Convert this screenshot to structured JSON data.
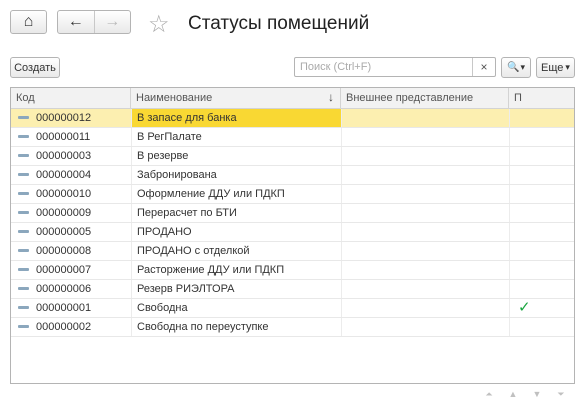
{
  "window": {
    "title": "Статусы помещений"
  },
  "toolbar": {
    "create_label": "Создать",
    "search_placeholder": "Поиск (Ctrl+F)",
    "clear_glyph": "×",
    "search_glyph": "🔍",
    "dropdown_glyph": "▾",
    "more_label": "Еще",
    "more_glyph": "▾"
  },
  "nav": {
    "home_glyph": "⌂",
    "back_glyph": "←",
    "forward_glyph": "→",
    "star_glyph": "☆"
  },
  "table": {
    "columns": [
      "Код",
      "Наименование",
      "Внешнее представление",
      "П"
    ],
    "sort_indicator": "↓",
    "rows": [
      {
        "code": "000000012",
        "name": "В запасе для банка",
        "ext": "",
        "p": ""
      },
      {
        "code": "000000011",
        "name": "В РегПалате",
        "ext": "",
        "p": ""
      },
      {
        "code": "000000003",
        "name": "В резерве",
        "ext": "",
        "p": ""
      },
      {
        "code": "000000004",
        "name": "Забронирована",
        "ext": "",
        "p": ""
      },
      {
        "code": "000000010",
        "name": "Оформление ДДУ или ПДКП",
        "ext": "",
        "p": ""
      },
      {
        "code": "000000009",
        "name": "Перерасчет по БТИ",
        "ext": "",
        "p": ""
      },
      {
        "code": "000000005",
        "name": "ПРОДАНО",
        "ext": "",
        "p": ""
      },
      {
        "code": "000000008",
        "name": "ПРОДАНО с отделкой",
        "ext": "",
        "p": ""
      },
      {
        "code": "000000007",
        "name": "Расторжение ДДУ или ПДКП",
        "ext": "",
        "p": ""
      },
      {
        "code": "000000006",
        "name": "Резерв РИЭЛТОРА",
        "ext": "",
        "p": ""
      },
      {
        "code": "000000001",
        "name": "Свободна",
        "ext": "",
        "p": "✓"
      },
      {
        "code": "000000002",
        "name": "Свободна по переуступке",
        "ext": "",
        "p": ""
      }
    ]
  },
  "pager": {
    "first": "⏶",
    "prev": "▲",
    "next": "▼",
    "last": "⏷"
  },
  "colors": {
    "selected_row": "#fcefb0",
    "selected_cell": "#f9d833",
    "check": "#1aa640"
  }
}
